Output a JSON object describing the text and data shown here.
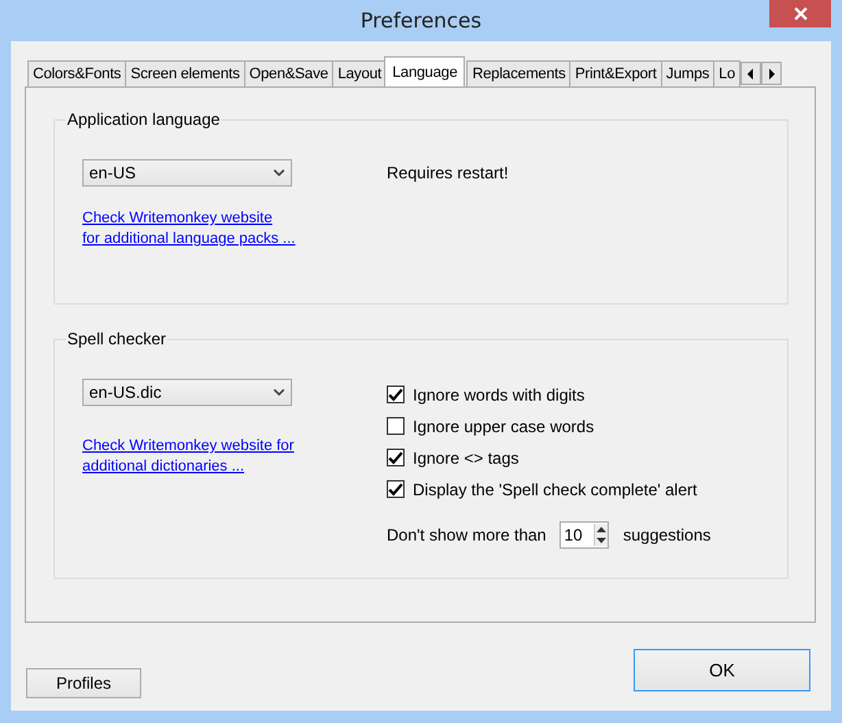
{
  "window": {
    "title": "Preferences"
  },
  "tabs": [
    {
      "label": "Colors&Fonts",
      "selected": false
    },
    {
      "label": "Screen elements",
      "selected": false
    },
    {
      "label": "Open&Save",
      "selected": false
    },
    {
      "label": "Layout",
      "selected": false
    },
    {
      "label": "Language",
      "selected": true
    },
    {
      "label": "Replacements",
      "selected": false
    },
    {
      "label": "Print&Export",
      "selected": false
    },
    {
      "label": "Jumps",
      "selected": false
    },
    {
      "label": "Lo",
      "selected": false
    }
  ],
  "app_language": {
    "title": "Application language",
    "dropdown": "en-US",
    "note": "Requires restart!",
    "link": [
      "Check Writemonkey website",
      "for additional language packs ..."
    ]
  },
  "spell_checker": {
    "title": "Spell checker",
    "dropdown": "en-US.dic",
    "link": [
      "Check Writemonkey website for",
      "additional dictionaries ..."
    ],
    "options": [
      {
        "label": "Ignore words with digits",
        "checked": true
      },
      {
        "label": "Ignore upper case words",
        "checked": false
      },
      {
        "label": "Ignore <> tags",
        "checked": true
      },
      {
        "label": "Display the 'Spell check complete' alert",
        "checked": true
      }
    ],
    "limit": {
      "before": "Don't show more than",
      "value": "10",
      "after": "suggestions"
    }
  },
  "buttons": {
    "profiles": "Profiles",
    "ok": "OK"
  }
}
